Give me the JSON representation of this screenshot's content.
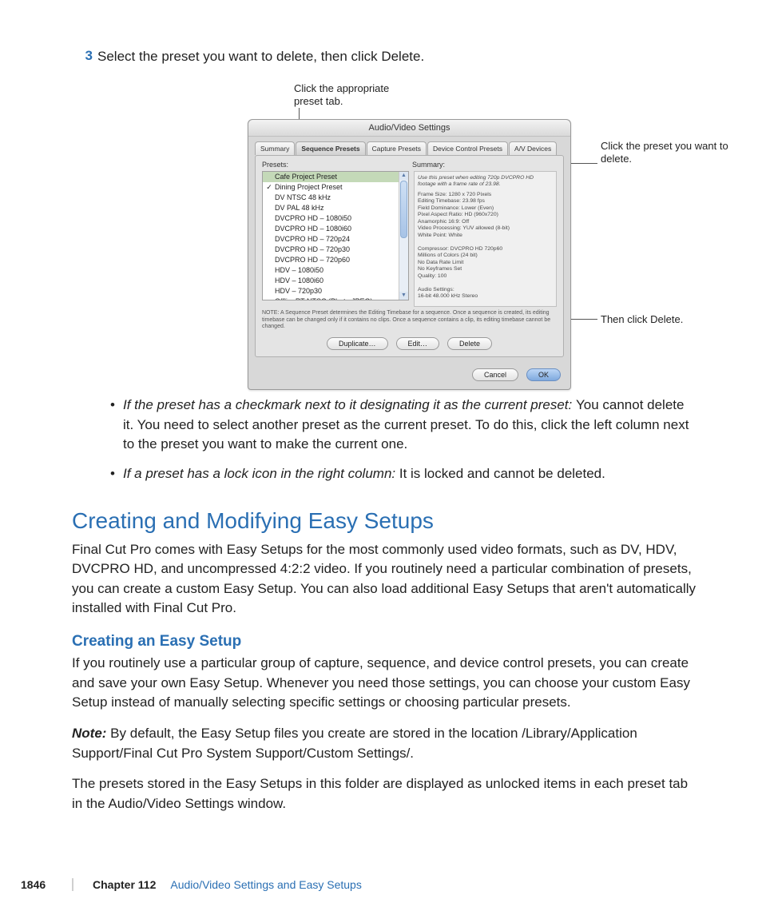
{
  "step": {
    "num": "3",
    "text": "Select the preset you want to delete, then click Delete."
  },
  "callouts": {
    "tab": "Click the appropriate preset tab.",
    "preset": "Click the preset you want to delete.",
    "delete": "Then click Delete."
  },
  "dialog": {
    "title": "Audio/Video Settings",
    "tabs": [
      "Summary",
      "Sequence Presets",
      "Capture Presets",
      "Device Control Presets",
      "A/V Devices"
    ],
    "active_tab": 1,
    "presets_label": "Presets:",
    "summary_label": "Summary:",
    "presets": [
      {
        "checked": false,
        "name": "Cafe Project Preset",
        "locked": false,
        "selected": true
      },
      {
        "checked": true,
        "name": "Dining Project Preset",
        "locked": false
      },
      {
        "checked": false,
        "name": "DV NTSC 48 kHz",
        "locked": true
      },
      {
        "checked": false,
        "name": "DV PAL 48 kHz",
        "locked": true
      },
      {
        "checked": false,
        "name": "DVCPRO HD – 1080i50",
        "locked": true
      },
      {
        "checked": false,
        "name": "DVCPRO HD – 1080i60",
        "locked": true
      },
      {
        "checked": false,
        "name": "DVCPRO HD – 720p24",
        "locked": true
      },
      {
        "checked": false,
        "name": "DVCPRO HD – 720p30",
        "locked": true
      },
      {
        "checked": false,
        "name": "DVCPRO HD – 720p60",
        "locked": true
      },
      {
        "checked": false,
        "name": "HDV – 1080i50",
        "locked": true
      },
      {
        "checked": false,
        "name": "HDV – 1080i60",
        "locked": true
      },
      {
        "checked": false,
        "name": "HDV – 720p30",
        "locked": true
      },
      {
        "checked": false,
        "name": "OfflineRT NTSC (Photo JPEG)",
        "locked": true
      }
    ],
    "summary_intro": "Use this preset when editing 720p DVCPRO HD footage with a frame rate of 23.98.",
    "summary_lines": [
      "Frame Size: 1280 x 720 Pixels",
      "Editing Timebase: 23.98 fps",
      "Field Dominance: Lower (Even)",
      "Pixel Aspect Ratio: HD (960x720)",
      "Anamorphic 16:9: Off",
      "Video Processing: YUV allowed (8-bit)",
      "White Point: White",
      "",
      "Compressor: DVCPRO HD 720p60",
      "Millions of Colors (24 bit)",
      "No Data Rate Limit",
      "No Keyframes Set",
      "Quality: 100",
      "",
      "Audio Settings:",
      "16-bit 48.000 kHz Stereo"
    ],
    "note": "NOTE: A Sequence Preset determines the Editing Timebase for a sequence. Once a sequence is created, its editing timebase can be changed only if it contains no clips. Once a sequence contains a clip, its editing timebase cannot be changed.",
    "buttons": {
      "duplicate": "Duplicate…",
      "edit": "Edit…",
      "delete": "Delete",
      "cancel": "Cancel",
      "ok": "OK"
    }
  },
  "bullets": [
    {
      "lead": "If the preset has a checkmark next to it designating it as the current preset:  ",
      "rest": "You cannot delete it. You need to select another preset as the current preset. To do this, click the left column next to the preset you want to make the current one."
    },
    {
      "lead": "If a preset has a lock icon in the right column:  ",
      "rest": "It is locked and cannot be deleted."
    }
  ],
  "h1": "Creating and Modifying Easy Setups",
  "p1": "Final Cut Pro comes with Easy Setups for the most commonly used video formats, such as DV, HDV, DVCPRO HD, and uncompressed 4:2:2 video. If you routinely need a particular combination of presets, you can create a custom Easy Setup. You can also load additional Easy Setups that aren't automatically installed with Final Cut Pro.",
  "h2": "Creating an Easy Setup",
  "p2": "If you routinely use a particular group of capture, sequence, and device control presets, you can create and save your own Easy Setup. Whenever you need those settings, you can choose your custom Easy Setup instead of manually selecting specific settings or choosing particular presets.",
  "note_label": "Note:  ",
  "p3": "By default, the Easy Setup files you create are stored in the location /Library/Application Support/Final Cut Pro System Support/Custom Settings/.",
  "p4": "The presets stored in the Easy Setups in this folder are displayed as unlocked items in each preset tab in the Audio/Video Settings window.",
  "footer": {
    "page": "1846",
    "chapter": "Chapter 112",
    "title": "Audio/Video Settings and Easy Setups"
  }
}
